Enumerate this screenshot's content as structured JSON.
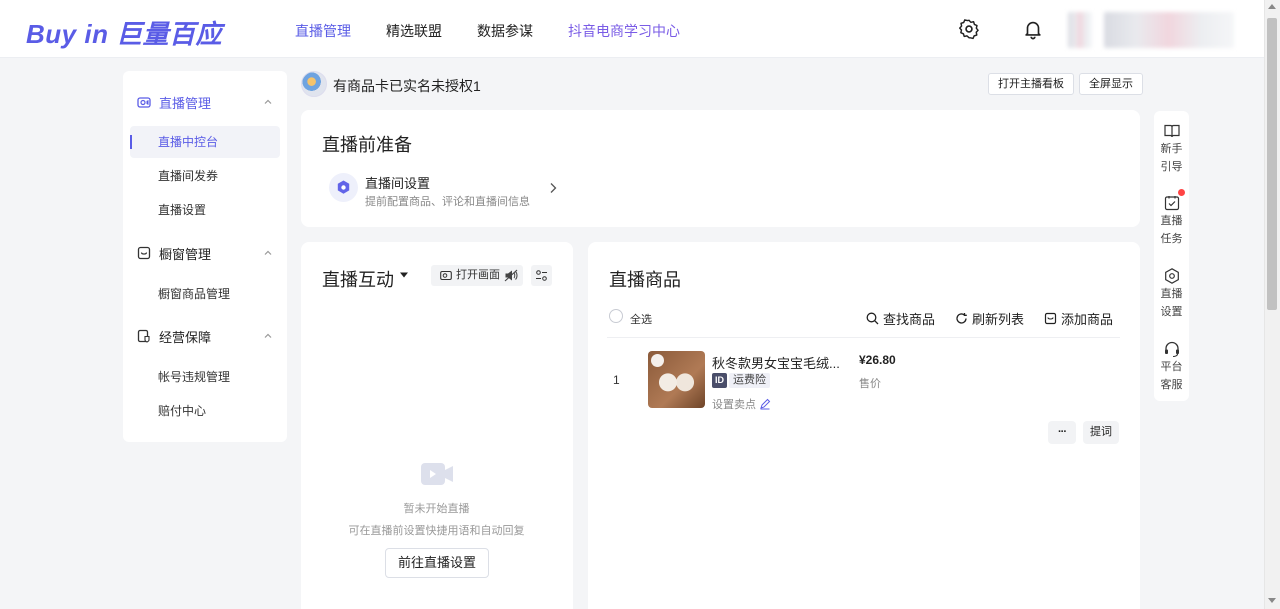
{
  "header": {
    "logo": "Buy in 巨量百应",
    "nav": [
      "直播管理",
      "精选联盟",
      "数据参谋",
      "抖音电商学习中心"
    ]
  },
  "sidebar": {
    "groups": [
      {
        "label": "直播管理",
        "items": [
          "直播中控台",
          "直播间发券",
          "直播设置"
        ]
      },
      {
        "label": "橱窗管理",
        "items": [
          "橱窗商品管理"
        ]
      },
      {
        "label": "经营保障",
        "items": [
          "帐号违规管理",
          "赔付中心"
        ]
      }
    ]
  },
  "titlebar": {
    "room_name": "有商品卡已实名未授权1",
    "btn_board": "打开主播看板",
    "btn_fullscreen": "全屏显示"
  },
  "prep": {
    "title": "直播前准备",
    "setting_name": "直播间设置",
    "setting_desc": "提前配置商品、评论和直播间信息"
  },
  "interact": {
    "title": "直播互动",
    "open_screen": "打开画面",
    "empty_title": "暂未开始直播",
    "empty_desc": "可在直播前设置快捷用语和自动回复",
    "goto_btn": "前往直播设置"
  },
  "products": {
    "title": "直播商品",
    "select_all": "全选",
    "find": "查找商品",
    "refresh": "刷新列表",
    "add": "添加商品",
    "rows": [
      {
        "index": "1",
        "name": "秋冬款男女宝宝毛绒...",
        "id_badge": "ID",
        "tag": "运费险",
        "sell_point": "设置卖点",
        "price": "¥26.80",
        "price_label": "售价",
        "more": "···",
        "prompt": "提词"
      }
    ]
  },
  "rail": [
    {
      "label1": "新手",
      "label2": "引导",
      "icon": "book-icon"
    },
    {
      "label1": "直播",
      "label2": "任务",
      "icon": "task-icon"
    },
    {
      "label1": "直播",
      "label2": "设置",
      "icon": "hexagon-settings-icon"
    },
    {
      "label1": "平台",
      "label2": "客服",
      "icon": "headset-icon"
    }
  ],
  "colors": {
    "accent": "#5a5ce6",
    "background": "#f4f5f7"
  }
}
